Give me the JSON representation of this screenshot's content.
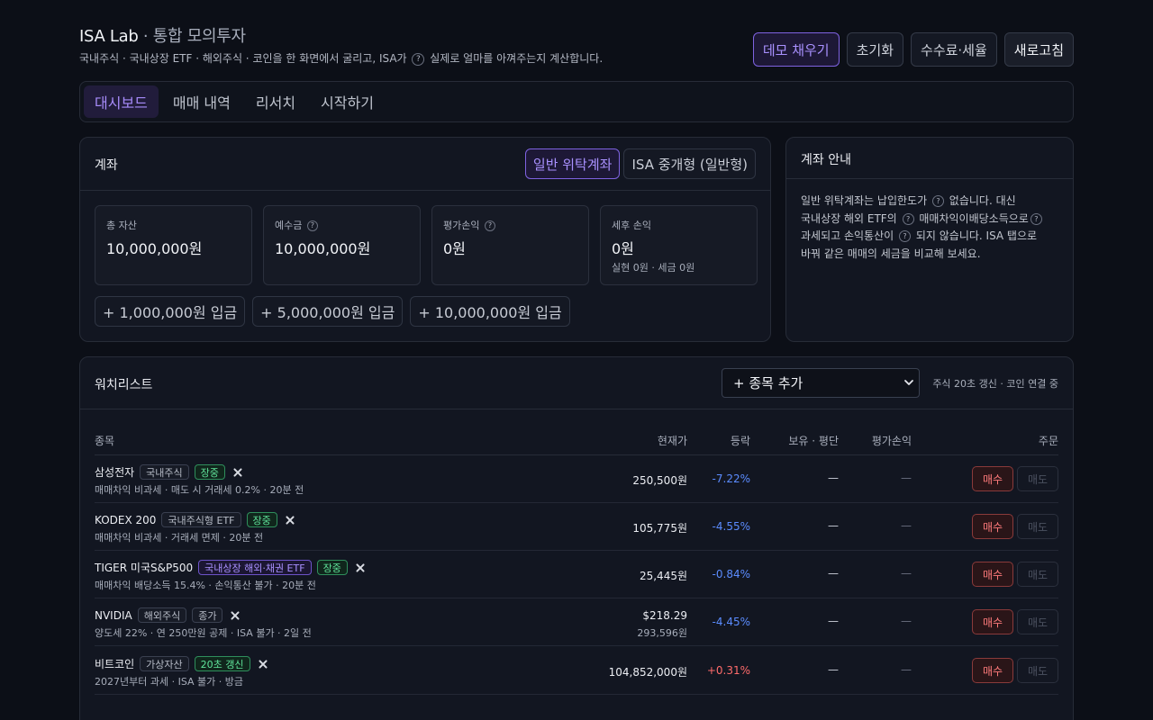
{
  "header": {
    "title_main": "ISA Lab",
    "title_sep": " · ",
    "title_sub": "통합 모의투자",
    "subtitle_a": "국내주식 · 국내상장 ETF · 해외주식 · 코인을 한 화면에서 굴리고, ISA가",
    "subtitle_q": "?",
    "subtitle_b": "실제로 얼마를 아껴주는지 계산합니다.",
    "buttons": {
      "demo": "데모 채우기",
      "reset": "초기화",
      "fees": "수수료·세율",
      "refresh": "새로고침"
    }
  },
  "tabs": [
    "대시보드",
    "매매 내역",
    "리서치",
    "시작하기"
  ],
  "account": {
    "title": "계좌",
    "segments": [
      "일반 위탁계좌",
      "ISA 중개형 (일반형)"
    ],
    "cards": [
      {
        "label": "총 자산",
        "has_help": false,
        "value": "10,000,000원",
        "note": ""
      },
      {
        "label": "예수금",
        "has_help": true,
        "value": "10,000,000원",
        "note": ""
      },
      {
        "label": "평가손익",
        "has_help": true,
        "value": "0원",
        "note": ""
      },
      {
        "label": "세후 손익",
        "has_help": false,
        "value": "0원",
        "note": "실현 0원 · 세금 0원"
      }
    ],
    "deposits": [
      "+ 1,000,000원 입금",
      "+ 5,000,000원 입금",
      "+ 10,000,000원 입금"
    ]
  },
  "guide": {
    "title": "계좌 안내",
    "t1": "일반 위탁계좌는 납입한도가",
    "t2": "없습니다. 대신",
    "t3": "국내상장 해외 ETF의",
    "t4": "매매차익이배당소득으로",
    "t5": "과세되고 손익통산이",
    "t6": "되지 않습니다. ISA 탭으로",
    "t7": "바꿔 같은 매매의 세금을 비교해 보세요.",
    "q": "?"
  },
  "watchlist": {
    "title": "워치리스트",
    "add_label": "+ 종목 추가",
    "refresh_note": "주식 20초 갱신 · 코인 연결 중",
    "columns": {
      "name": "종목",
      "price": "현재가",
      "change": "등락",
      "holding": "보유 · 평단",
      "pnl": "평가손익",
      "order": "주문"
    },
    "rows": [
      {
        "name": "삼성전자",
        "tags": [
          {
            "text": "국내주식",
            "style": "plain"
          },
          {
            "text": "장중",
            "style": "green"
          }
        ],
        "desc": "매매차익 비과세 · 매도 시 거래세 0.2% · 20분 전",
        "price": "250,500원",
        "price_sub": "",
        "change": "-7.22%",
        "dir": "down",
        "holding": "—",
        "pnl": "—"
      },
      {
        "name": "KODEX 200",
        "tags": [
          {
            "text": "국내주식형 ETF",
            "style": "plain"
          },
          {
            "text": "장중",
            "style": "green"
          }
        ],
        "desc": "매매차익 비과세 · 거래세 면제 · 20분 전",
        "price": "105,775원",
        "price_sub": "",
        "change": "-4.55%",
        "dir": "down",
        "holding": "—",
        "pnl": "—"
      },
      {
        "name": "TIGER 미국S&P500",
        "tags": [
          {
            "text": "국내상장 해외·채권 ETF",
            "style": "purple"
          },
          {
            "text": "장중",
            "style": "green"
          }
        ],
        "desc": "매매차익 배당소득 15.4% · 손익통산 불가 · 20분 전",
        "price": "25,445원",
        "price_sub": "",
        "change": "-0.84%",
        "dir": "down",
        "holding": "—",
        "pnl": "—"
      },
      {
        "name": "NVIDIA",
        "tags": [
          {
            "text": "해외주식",
            "style": "plain"
          },
          {
            "text": "종가",
            "style": "plain"
          }
        ],
        "desc": "양도세 22% · 연 250만원 공제 · ISA 불가 · 2일 전",
        "price": "$218.29",
        "price_sub": "293,596원",
        "change": "-4.45%",
        "dir": "down",
        "holding": "—",
        "pnl": "—"
      },
      {
        "name": "비트코인",
        "tags": [
          {
            "text": "가상자산",
            "style": "plain"
          },
          {
            "text": "20초 갱신",
            "style": "green"
          }
        ],
        "desc": "2027년부터 과세 · ISA 불가 · 방금",
        "price": "104,852,000원",
        "price_sub": "",
        "change": "+0.31%",
        "dir": "up",
        "holding": "—",
        "pnl": "—"
      }
    ],
    "buy_label": "매수",
    "sell_label": "매도"
  }
}
